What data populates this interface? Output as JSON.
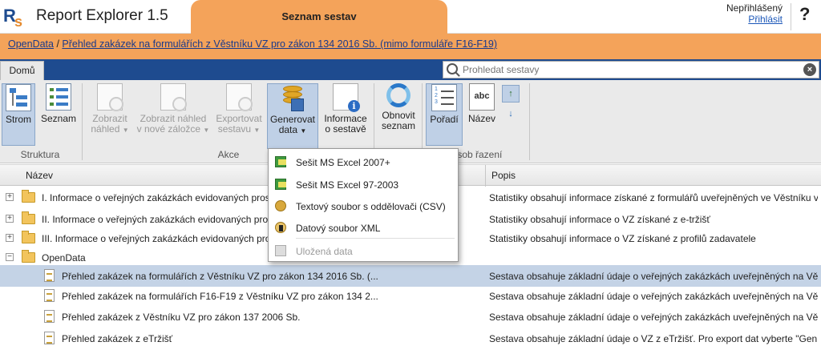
{
  "header": {
    "app_title": "Report Explorer 1.5",
    "center_tab": "Seznam sestav",
    "user_status": "Nepřihlášený",
    "login_link": "Přihlásit",
    "help": "?"
  },
  "breadcrumb": {
    "root": "OpenData",
    "separator": " / ",
    "current": "Přehled zakázek na formulářích z Věstníku VZ pro zákon 134 2016 Sb. (mimo formuláře F16-F19)"
  },
  "ribbon_tabs": {
    "home": "Domů"
  },
  "search": {
    "placeholder": "Prohledat sestavy"
  },
  "ribbon": {
    "tree": "Strom",
    "list": "Seznam",
    "group_structure": "Struktura",
    "show_preview_1": "Zobrazit",
    "show_preview_2": "náhled",
    "show_new_tab_1": "Zobrazit náhled",
    "show_new_tab_2": "v nové záložce",
    "export_1": "Exportovat",
    "export_2": "sestavu",
    "generate_1": "Generovat",
    "generate_2": "data",
    "info_1": "Informace",
    "info_2": "o sestavě",
    "group_actions": "Akce",
    "refresh_1": "Obnovit",
    "refresh_2": "seznam",
    "order": "Pořadí",
    "name": "Název",
    "group_sort": "ůsob řazení"
  },
  "dropdown": {
    "items": [
      "Sešit MS Excel 2007+",
      "Sešit MS Excel 97-2003",
      "Textový soubor s oddělovači (CSV)",
      "Datový soubor XML",
      "Uložená data"
    ]
  },
  "grid": {
    "col_name": "Název",
    "col_desc": "Popis",
    "rows": [
      {
        "name": "I. Informace o veřejných zakázkách evidovaných prost",
        "desc": "Statistiky obsahují informace získané z formulářů uveřejněných ve Věstníku v..."
      },
      {
        "name": "II. Informace o veřejných zakázkách evidovaných pros",
        "desc": "Statistiky obsahují informace o VZ získané z e-tržišť"
      },
      {
        "name": "III. Informace o veřejných zakázkách evidovaných pro",
        "desc": "Statistiky obsahují informace o VZ získané z profilů zadavatele"
      },
      {
        "name": "OpenData",
        "desc": ""
      },
      {
        "name": "Přehled zakázek na formulářích z Věstníku VZ pro zákon 134 2016 Sb. (...",
        "desc": "Sestava obsahuje základní údaje o veřejných zakázkách uveřejněných na Vě..."
      },
      {
        "name": "Přehled zakázek na formulářích F16-F19 z Věstníku VZ pro zákon 134 2...",
        "desc": "Sestava obsahuje základní údaje o veřejných zakázkách uveřejněných na Vě..."
      },
      {
        "name": "Přehled zakázek z Věstníku VZ pro zákon 137 2006 Sb.",
        "desc": "Sestava obsahuje základní údaje o veřejných zakázkách uveřejněných na Vě..."
      },
      {
        "name": "Přehled zakázek z eTržišť",
        "desc": "Sestava obsahuje základní údaje o VZ z eTržišť. Pro export dat vyberte \"Gen..."
      }
    ]
  }
}
